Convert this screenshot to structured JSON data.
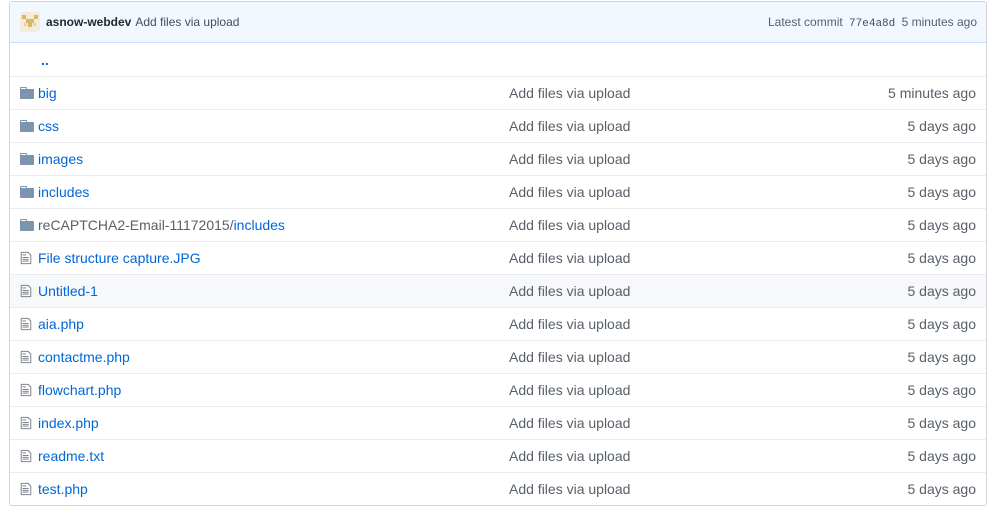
{
  "commit": {
    "author": "asnow-webdev",
    "message": "Add files via upload",
    "latest_label": "Latest commit",
    "sha": "77e4a8d",
    "age": "5 minutes ago",
    "avatar_icon": "identicon-avatar"
  },
  "parent_link": "..",
  "rows": [
    {
      "type": "folder",
      "icon": "folder-icon",
      "name": "big",
      "prefix": "",
      "message": "Add files via upload",
      "age": "5 minutes ago"
    },
    {
      "type": "folder",
      "icon": "folder-icon",
      "name": "css",
      "prefix": "",
      "message": "Add files via upload",
      "age": "5 days ago"
    },
    {
      "type": "folder",
      "icon": "folder-icon",
      "name": "images",
      "prefix": "",
      "message": "Add files via upload",
      "age": "5 days ago"
    },
    {
      "type": "folder",
      "icon": "folder-icon",
      "name": "includes",
      "prefix": "",
      "message": "Add files via upload",
      "age": "5 days ago"
    },
    {
      "type": "folder",
      "icon": "folder-icon",
      "name": "includes",
      "prefix": "reCAPTCHA2-Email-11172015/",
      "message": "Add files via upload",
      "age": "5 days ago"
    },
    {
      "type": "file",
      "icon": "file-icon",
      "name": "File structure capture.JPG",
      "prefix": "",
      "message": "Add files via upload",
      "age": "5 days ago"
    },
    {
      "type": "file",
      "icon": "file-icon",
      "name": "Untitled-1",
      "prefix": "",
      "message": "Add files via upload",
      "age": "5 days ago"
    },
    {
      "type": "file",
      "icon": "file-icon",
      "name": "aia.php",
      "prefix": "",
      "message": "Add files via upload",
      "age": "5 days ago"
    },
    {
      "type": "file",
      "icon": "file-icon",
      "name": "contactme.php",
      "prefix": "",
      "message": "Add files via upload",
      "age": "5 days ago"
    },
    {
      "type": "file",
      "icon": "file-icon",
      "name": "flowchart.php",
      "prefix": "",
      "message": "Add files via upload",
      "age": "5 days ago"
    },
    {
      "type": "file",
      "icon": "file-icon",
      "name": "index.php",
      "prefix": "",
      "message": "Add files via upload",
      "age": "5 days ago"
    },
    {
      "type": "file",
      "icon": "file-icon",
      "name": "readme.txt",
      "prefix": "",
      "message": "Add files via upload",
      "age": "5 days ago"
    },
    {
      "type": "file",
      "icon": "file-icon",
      "name": "test.php",
      "prefix": "",
      "message": "Add files via upload",
      "age": "5 days ago"
    }
  ],
  "colors": {
    "link": "#0366d6",
    "muted": "#586069",
    "folder": "#79b8ff",
    "file": "#6a737d",
    "tease_bg": "#f1f8ff"
  }
}
